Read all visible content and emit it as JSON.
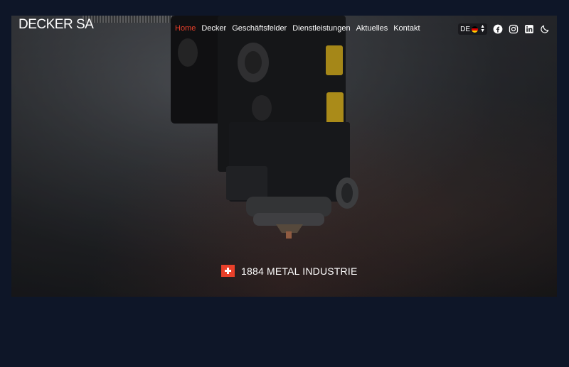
{
  "brand": {
    "logo_text": "DECKER SA"
  },
  "nav": {
    "items": [
      {
        "label": "Home",
        "active": true
      },
      {
        "label": "Decker",
        "active": false
      },
      {
        "label": "Geschäftsfelder",
        "active": false
      },
      {
        "label": "Dienstleistungen",
        "active": false
      },
      {
        "label": "Aktuelles",
        "active": false
      },
      {
        "label": "Kontakt",
        "active": false
      }
    ]
  },
  "tools": {
    "language": {
      "code": "DE",
      "flag": "germany-flag-icon"
    },
    "social": [
      "facebook-icon",
      "instagram-icon",
      "linkedin-icon"
    ],
    "theme_toggle": "moon-icon"
  },
  "hero": {
    "tagline": "1884 METAL INDUSTRIE",
    "tagline_icon": "swiss-flag-icon"
  },
  "colors": {
    "page_bg": "#0e1628",
    "accent": "#e8402a",
    "text": "#ffffff"
  }
}
